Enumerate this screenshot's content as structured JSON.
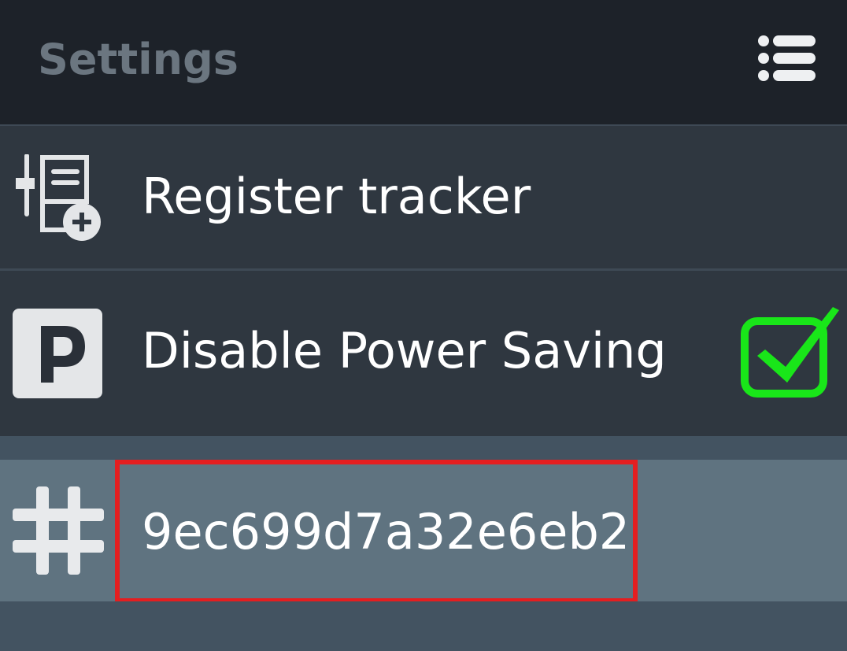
{
  "header": {
    "title": "Settings",
    "menu_icon": "list-menu-icon"
  },
  "rows": [
    {
      "label": "Register tracker",
      "icon": "register-tracker-icon"
    },
    {
      "label": "Disable Power Saving",
      "icon": "parking-p-icon",
      "checked": true,
      "check_color": "#19e619"
    },
    {
      "label": "9ec699d7a32e6eb2",
      "icon": "hash-icon",
      "highlight_color": "#e41e20"
    }
  ],
  "colors": {
    "header_bg": "#1d2229",
    "row_bg": "#2f3740",
    "selected_row_bg": "#5f7380",
    "page_bg": "#435361",
    "title_text": "#6b7680"
  }
}
